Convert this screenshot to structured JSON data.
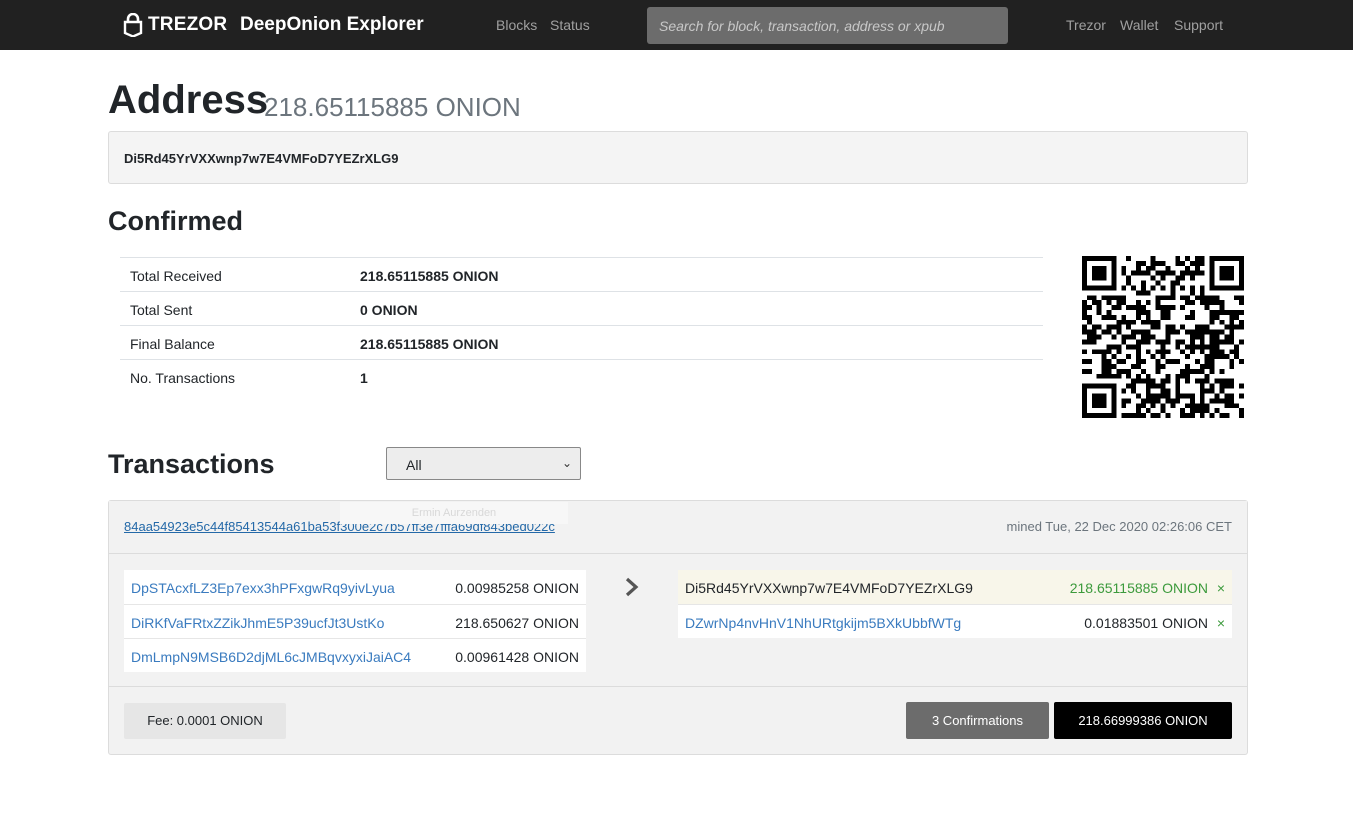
{
  "navbar": {
    "brand": "TREZOR",
    "title": "DeepOnion Explorer",
    "links": [
      "Blocks",
      "Status"
    ],
    "search_placeholder": "Search for block, transaction, address or xpub",
    "right_links": [
      "Trezor",
      "Wallet",
      "Support"
    ]
  },
  "header": {
    "title": "Address",
    "balance": "218.65115885 ONION",
    "address": "Di5Rd45YrVXXwnp7w7E4VMFoD7YEZrXLG9"
  },
  "confirmed": {
    "title": "Confirmed",
    "rows": [
      {
        "label": "Total Received",
        "value": "218.65115885 ONION"
      },
      {
        "label": "Total Sent",
        "value": "0 ONION"
      },
      {
        "label": "Final Balance",
        "value": "218.65115885 ONION"
      },
      {
        "label": "No. Transactions",
        "value": "1"
      }
    ]
  },
  "transactions": {
    "title": "Transactions",
    "filter_value": "All",
    "ghost_text": "Ermin Aurzenden",
    "tx": {
      "txid": "84aa54923e5c44f85413544a61ba53f300e2c7b57ff3e7fffa69df843bed022c",
      "mined": "mined Tue, 22 Dec 2020 02:26:06 CET",
      "inputs": [
        {
          "address": "DpSTAcxfLZ3Ep7exx3hPFxgwRq9yivLyua",
          "amount": "0.00985258 ONION"
        },
        {
          "address": "DiRKfVaFRtxZZikJhmE5P39ucfJt3UstKo",
          "amount": "218.650627 ONION"
        },
        {
          "address": "DmLmpN9MSB6D2djML6cJMBqvxyxiJaiAC4",
          "amount": "0.00961428 ONION"
        }
      ],
      "outputs": [
        {
          "address": "Di5Rd45YrVXXwnp7w7E4VMFoD7YEZrXLG9",
          "amount": "218.65115885 ONION",
          "mark": "×"
        },
        {
          "address": "DZwrNp4nvHnV1NhURtgkijm5BXkUbbfWTg",
          "amount": "0.01883501 ONION",
          "mark": "×"
        }
      ],
      "fee": "Fee: 0.0001 ONION",
      "confirmations": "3 Confirmations",
      "total": "218.66999386 ONION"
    }
  },
  "colors": {
    "navbar": "#212121",
    "link": "#2469a8",
    "positive": "#3c9a3c"
  }
}
